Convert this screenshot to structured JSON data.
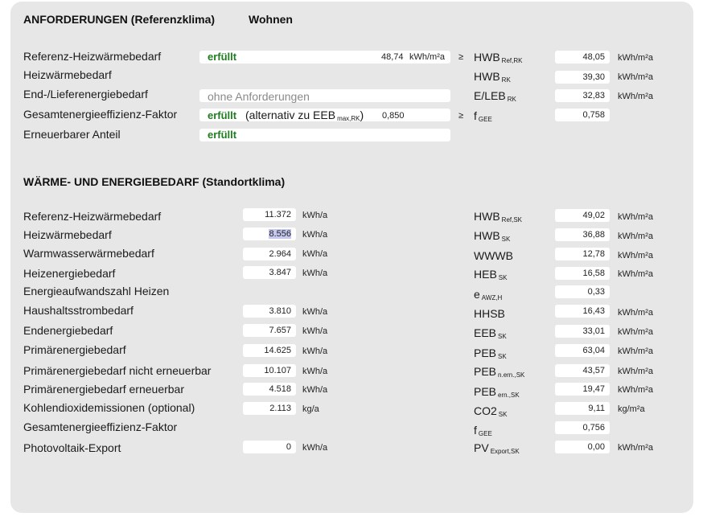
{
  "req": {
    "title": "ANFORDERUNGEN (Referenzklima)",
    "usage": "Wohnen",
    "geq": "≥",
    "rows": [
      {
        "label": "Referenz-Heizwärmebedarf",
        "status": "erfüllt",
        "value": "48,74",
        "unit": "kWh/m²a",
        "sym": "HWB",
        "sub": "Ref,RK",
        "rvalue": "48,05",
        "runit": "kWh/m²a"
      },
      {
        "label": "Heizwärmebedarf",
        "sym": "HWB",
        "sub": "RK",
        "rvalue": "39,30",
        "runit": "kWh/m²a"
      },
      {
        "label": "End-/Lieferenergiebedarf",
        "status_grey": "ohne Anforderungen",
        "sym": "E/LEB",
        "sub": "RK",
        "rvalue": "32,83",
        "runit": "kWh/m²a"
      },
      {
        "label": "Gesamtenergieeffizienz-Faktor",
        "status": "erfüllt",
        "alt_pre": "(alternativ zu EEB",
        "alt_sub": "max,RK",
        "alt_post": ")",
        "value": "0,850",
        "sym": "f",
        "sub": "GEE",
        "rvalue": "0,758"
      },
      {
        "label": "Erneuerbarer Anteil",
        "status": "erfüllt"
      }
    ]
  },
  "demand": {
    "title": "WÄRME- UND ENERGIEBEDARF (Standortklima)",
    "rows": [
      {
        "label": "Referenz-Heizwärmebedarf",
        "value": "11.372",
        "unit": "kWh/a",
        "sym": "HWB",
        "sub": "Ref,SK",
        "rvalue": "49,02",
        "runit": "kWh/m²a"
      },
      {
        "label": "Heizwärmebedarf",
        "value": "8.556",
        "unit": "kWh/a",
        "sym": "HWB",
        "sub": "SK",
        "rvalue": "36,88",
        "runit": "kWh/m²a"
      },
      {
        "label": "Warmwasserwärmebedarf",
        "value": "2.964",
        "unit": "kWh/a",
        "sym": "WWWB",
        "sub": "",
        "rvalue": "12,78",
        "runit": "kWh/m²a"
      },
      {
        "label": "Heizenergiebedarf",
        "value": "3.847",
        "unit": "kWh/a",
        "sym": "HEB",
        "sub": "SK",
        "rvalue": "16,58",
        "runit": "kWh/m²a"
      },
      {
        "label": "Energieaufwandszahl Heizen",
        "sym": "e",
        "sub": "AWZ,H",
        "rvalue": "0,33"
      },
      {
        "label": "Haushaltsstrombedarf",
        "value": "3.810",
        "unit": "kWh/a",
        "sym": "HHSB",
        "sub": "",
        "rvalue": "16,43",
        "runit": "kWh/m²a"
      },
      {
        "label": "Endenergiebedarf",
        "value": "7.657",
        "unit": "kWh/a",
        "sym": "EEB",
        "sub": "SK",
        "rvalue": "33,01",
        "runit": "kWh/m²a"
      },
      {
        "label": "Primärenergiebedarf",
        "value": "14.625",
        "unit": "kWh/a",
        "sym": "PEB",
        "sub": "SK",
        "rvalue": "63,04",
        "runit": "kWh/m²a"
      },
      {
        "label": "Primärenergiebedarf nicht erneuerbar",
        "value": "10.107",
        "unit": "kWh/a",
        "sym": "PEB",
        "sub": "n.ern.,SK",
        "rvalue": "43,57",
        "runit": "kWh/m²a"
      },
      {
        "label": "Primärenergiebedarf erneuerbar",
        "value": "4.518",
        "unit": "kWh/a",
        "sym": "PEB",
        "sub": "ern.,SK",
        "rvalue": "19,47",
        "runit": "kWh/m²a"
      },
      {
        "label": "Kohlendioxidemissionen (optional)",
        "value": "2.113",
        "unit": "kg/a",
        "sym": "CO2",
        "sub": "SK",
        "rvalue": "9,11",
        "runit": "kg/m²a"
      },
      {
        "label": "Gesamtenergieeffizienz-Faktor",
        "sym": "f",
        "sub": "GEE",
        "rvalue": "0,756"
      },
      {
        "label": "Photovoltaik-Export",
        "value": "0",
        "unit": "kWh/a",
        "sym": "PV",
        "sub": "Export,SK",
        "rvalue": "0,00",
        "runit": "kWh/m²a"
      }
    ]
  }
}
